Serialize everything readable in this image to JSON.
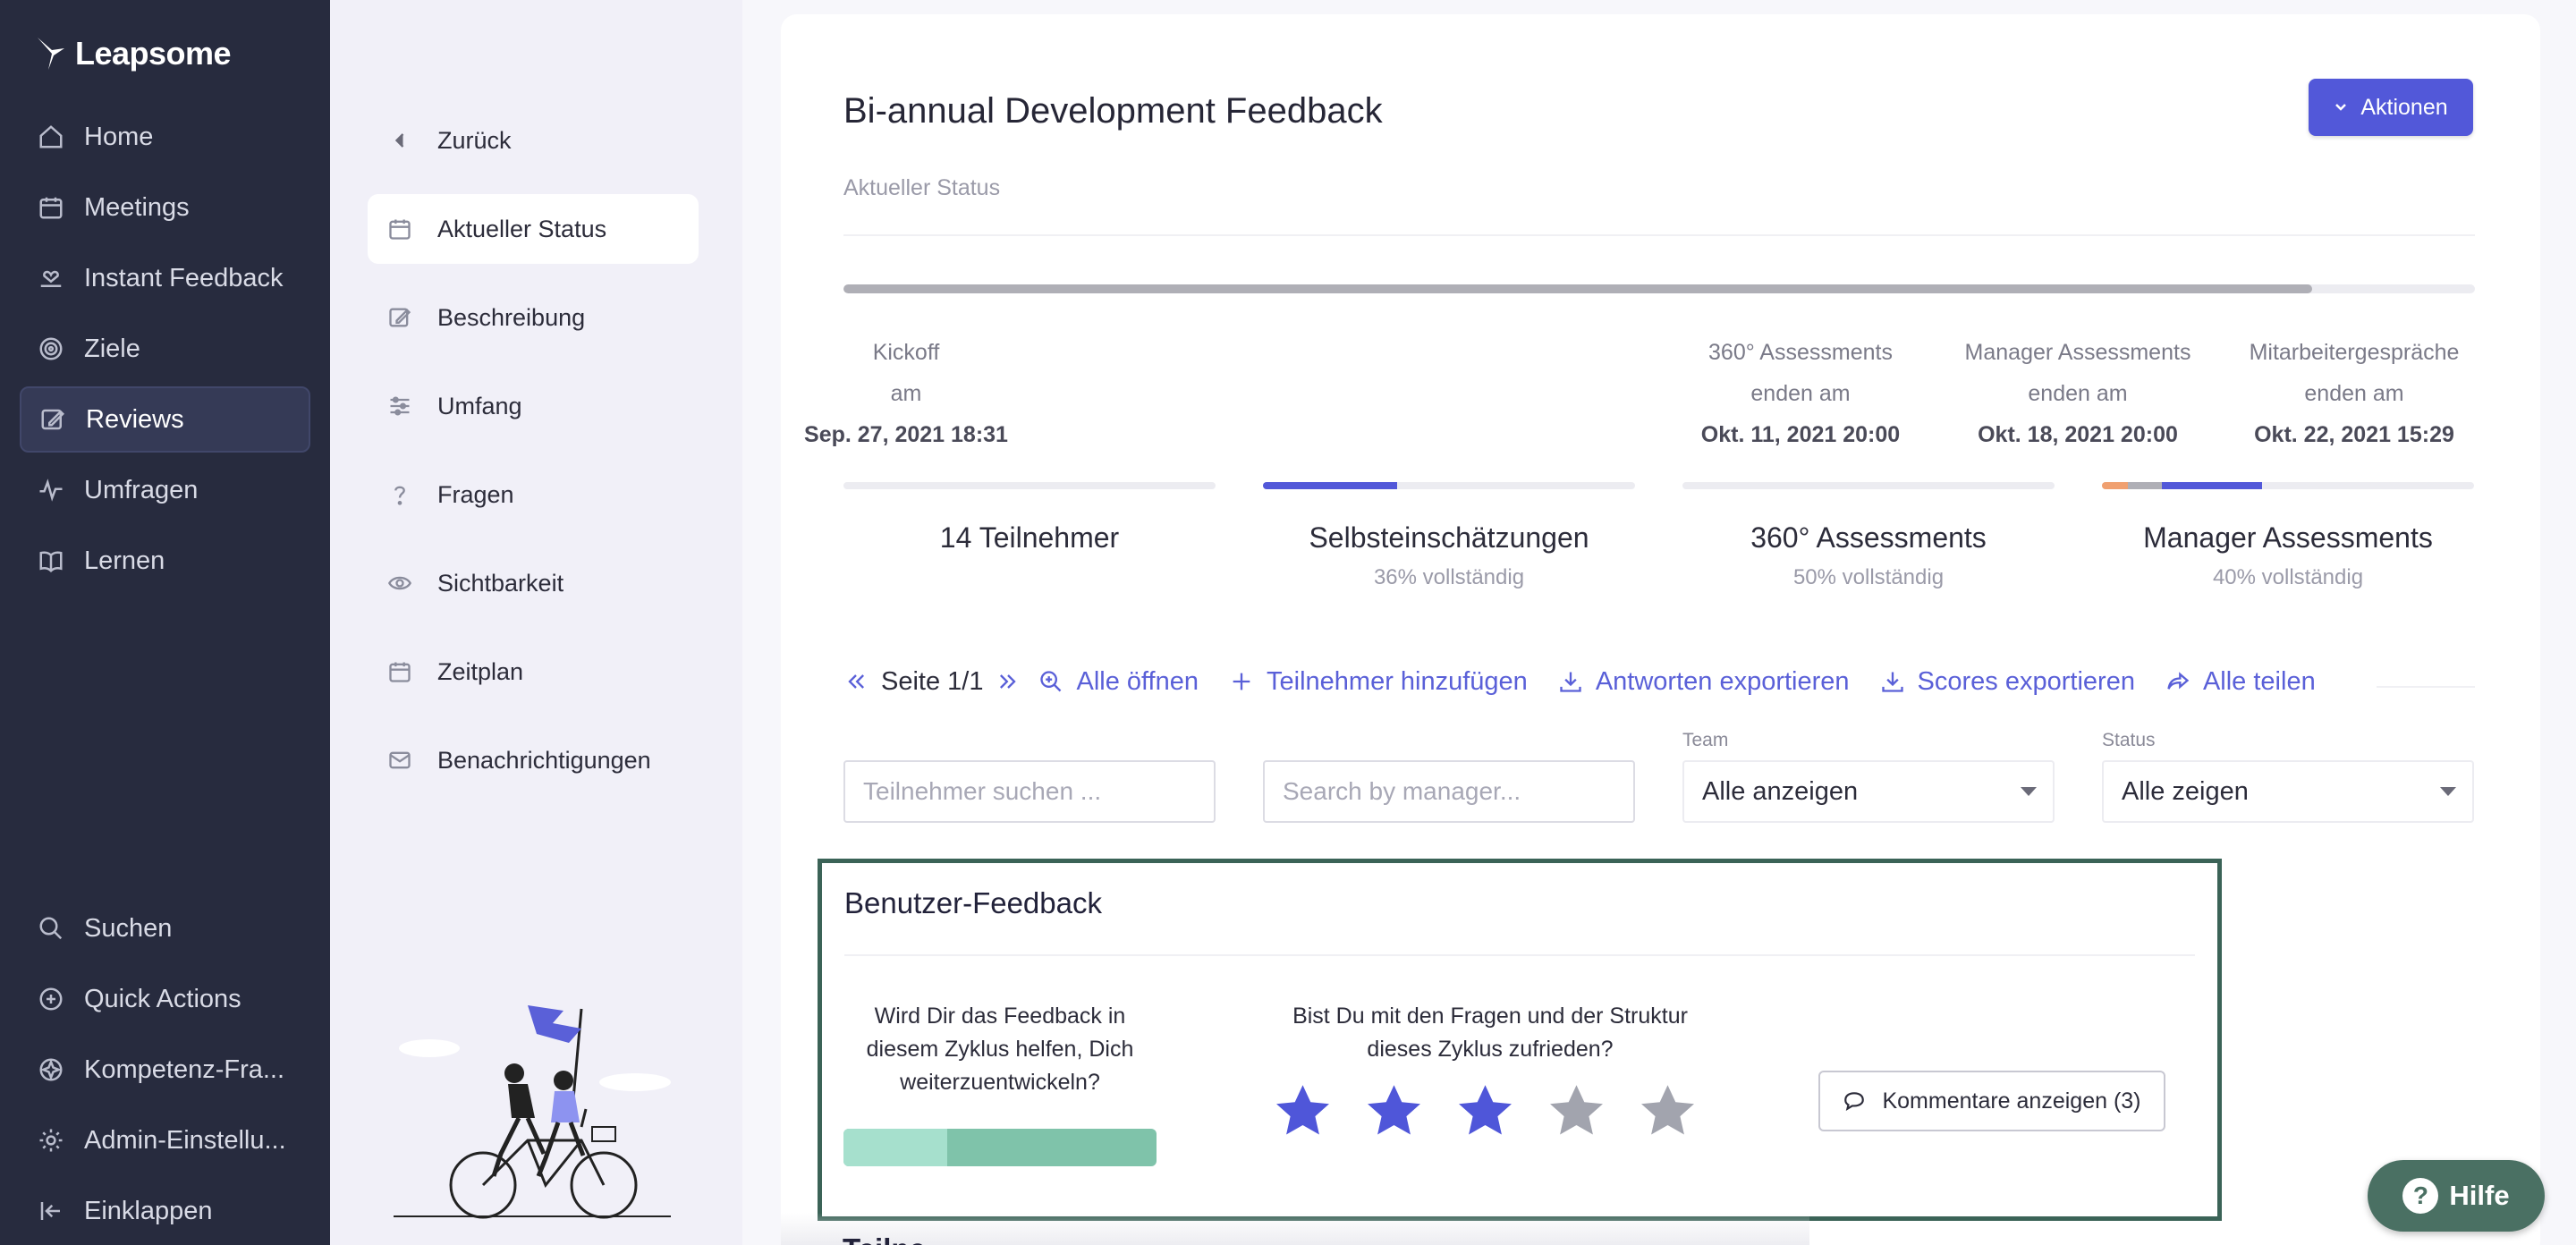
{
  "app": {
    "brand": "Leapsome"
  },
  "sidebar": {
    "items": [
      {
        "label": "Home",
        "icon": "home-icon"
      },
      {
        "label": "Meetings",
        "icon": "calendar-icon"
      },
      {
        "label": "Instant Feedback",
        "icon": "hand-heart-icon"
      },
      {
        "label": "Ziele",
        "icon": "target-icon"
      },
      {
        "label": "Reviews",
        "icon": "edit-icon",
        "active": true
      },
      {
        "label": "Umfragen",
        "icon": "pulse-icon"
      },
      {
        "label": "Lernen",
        "icon": "book-icon"
      }
    ],
    "bottom_items": [
      {
        "label": "Suchen",
        "icon": "search-icon"
      },
      {
        "label": "Quick Actions",
        "icon": "plus-circle-icon"
      },
      {
        "label": "Kompetenz-Fra...",
        "icon": "competency-icon"
      },
      {
        "label": "Admin-Einstellu...",
        "icon": "gear-icon"
      },
      {
        "label": "Einklappen",
        "icon": "collapse-icon"
      }
    ]
  },
  "subnav": {
    "back": "Zurück",
    "items": [
      {
        "label": "Aktueller Status",
        "icon": "calendar-icon",
        "active": true
      },
      {
        "label": "Beschreibung",
        "icon": "edit-icon"
      },
      {
        "label": "Umfang",
        "icon": "sliders-icon"
      },
      {
        "label": "Fragen",
        "icon": "question-icon"
      },
      {
        "label": "Sichtbarkeit",
        "icon": "eye-icon"
      },
      {
        "label": "Zeitplan",
        "icon": "calendar-icon"
      },
      {
        "label": "Benachrichtigungen",
        "icon": "mail-icon"
      }
    ]
  },
  "header": {
    "title": "Bi-annual Development Feedback",
    "subtitle": "Aktueller Status",
    "actions_label": "Aktionen"
  },
  "timeline": {
    "progress": 0.9,
    "milestones": [
      {
        "line1": "Kickoff",
        "line2": "am",
        "date": "Sep. 27, 2021 18:31"
      },
      {
        "line1": "360° Assessments",
        "line2": "enden am",
        "date": "Okt. 11, 2021 20:00"
      },
      {
        "line1": "Manager Assessments",
        "line2": "enden am",
        "date": "Okt. 18, 2021 20:00"
      },
      {
        "line1": "Mitarbeitergespräche",
        "line2": "enden am",
        "date": "Okt. 22, 2021 15:29"
      }
    ]
  },
  "phases": [
    {
      "title": "14 Teilnehmer",
      "sub": ""
    },
    {
      "title": "Selbsteinschätzungen",
      "sub": "36% vollständig",
      "progress": 0.36
    },
    {
      "title": "360° Assessments",
      "sub": "50% vollständig",
      "progress": 0.5
    },
    {
      "title": "Manager Assessments",
      "sub": "40% vollständig",
      "progress": 0.4
    }
  ],
  "toolbar": {
    "page": "Seite 1/1",
    "open_all": "Alle öffnen",
    "add_participants": "Teilnehmer hinzufügen",
    "export_answers": "Antworten exportieren",
    "export_scores": "Scores exportieren",
    "share_all": "Alle teilen"
  },
  "filters": {
    "participant_placeholder": "Teilnehmer suchen ...",
    "manager_placeholder": "Search by manager...",
    "team_label": "Team",
    "team_value": "Alle anzeigen",
    "status_label": "Status",
    "status_value": "Alle zeigen"
  },
  "feedback": {
    "title": "Benutzer-Feedback",
    "q1": "Wird Dir das Feedback in diesem Zyklus helfen, Dich weiterzuentwickeln?",
    "q1_split": 0.33,
    "q2": "Bist Du mit den Fragen und der Struktur dieses Zyklus zufrieden?",
    "rating": 3,
    "max_rating": 5,
    "comments_label": "Kommentare anzeigen (3)"
  },
  "cutoff_heading": "Teilne",
  "help": {
    "label": "Hilfe"
  },
  "colors": {
    "sidebar_bg": "#272b3e",
    "accent": "#5258d9",
    "feedback_border": "#3b6357",
    "star_active": "#4f56d9",
    "star_inactive": "#a2a4ae",
    "help_bg": "#4a7063"
  }
}
